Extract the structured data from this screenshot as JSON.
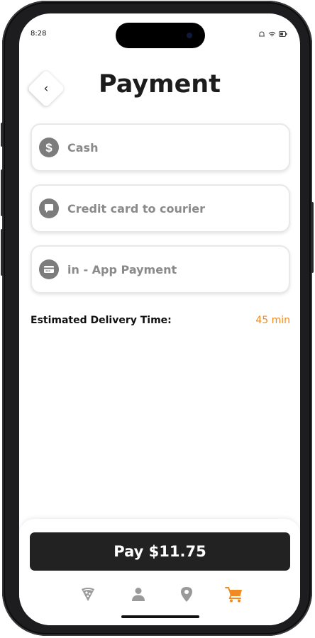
{
  "status_bar": {
    "time": "8:28"
  },
  "header": {
    "title": "Payment",
    "back_icon": "chevron-left-icon"
  },
  "payment_options": [
    {
      "label": "Cash",
      "icon": "dollar-icon"
    },
    {
      "label": "Credit card to courier",
      "icon": "chat-bubble-icon"
    },
    {
      "label": "in - App Payment",
      "icon": "credit-card-icon"
    }
  ],
  "delivery": {
    "label": "Estimated Delivery Time:",
    "value": "45 min"
  },
  "pay_button": {
    "label": "Pay $11.75"
  },
  "tab_bar": {
    "items": [
      {
        "icon": "pizza-icon",
        "active": false
      },
      {
        "icon": "user-icon",
        "active": false
      },
      {
        "icon": "location-pin-icon",
        "active": false
      },
      {
        "icon": "cart-icon",
        "active": true
      }
    ]
  },
  "colors": {
    "accent": "#f08a24",
    "button_dark": "#222222",
    "icon_gray": "#7c7c7c",
    "label_gray": "#8a8a8a"
  }
}
